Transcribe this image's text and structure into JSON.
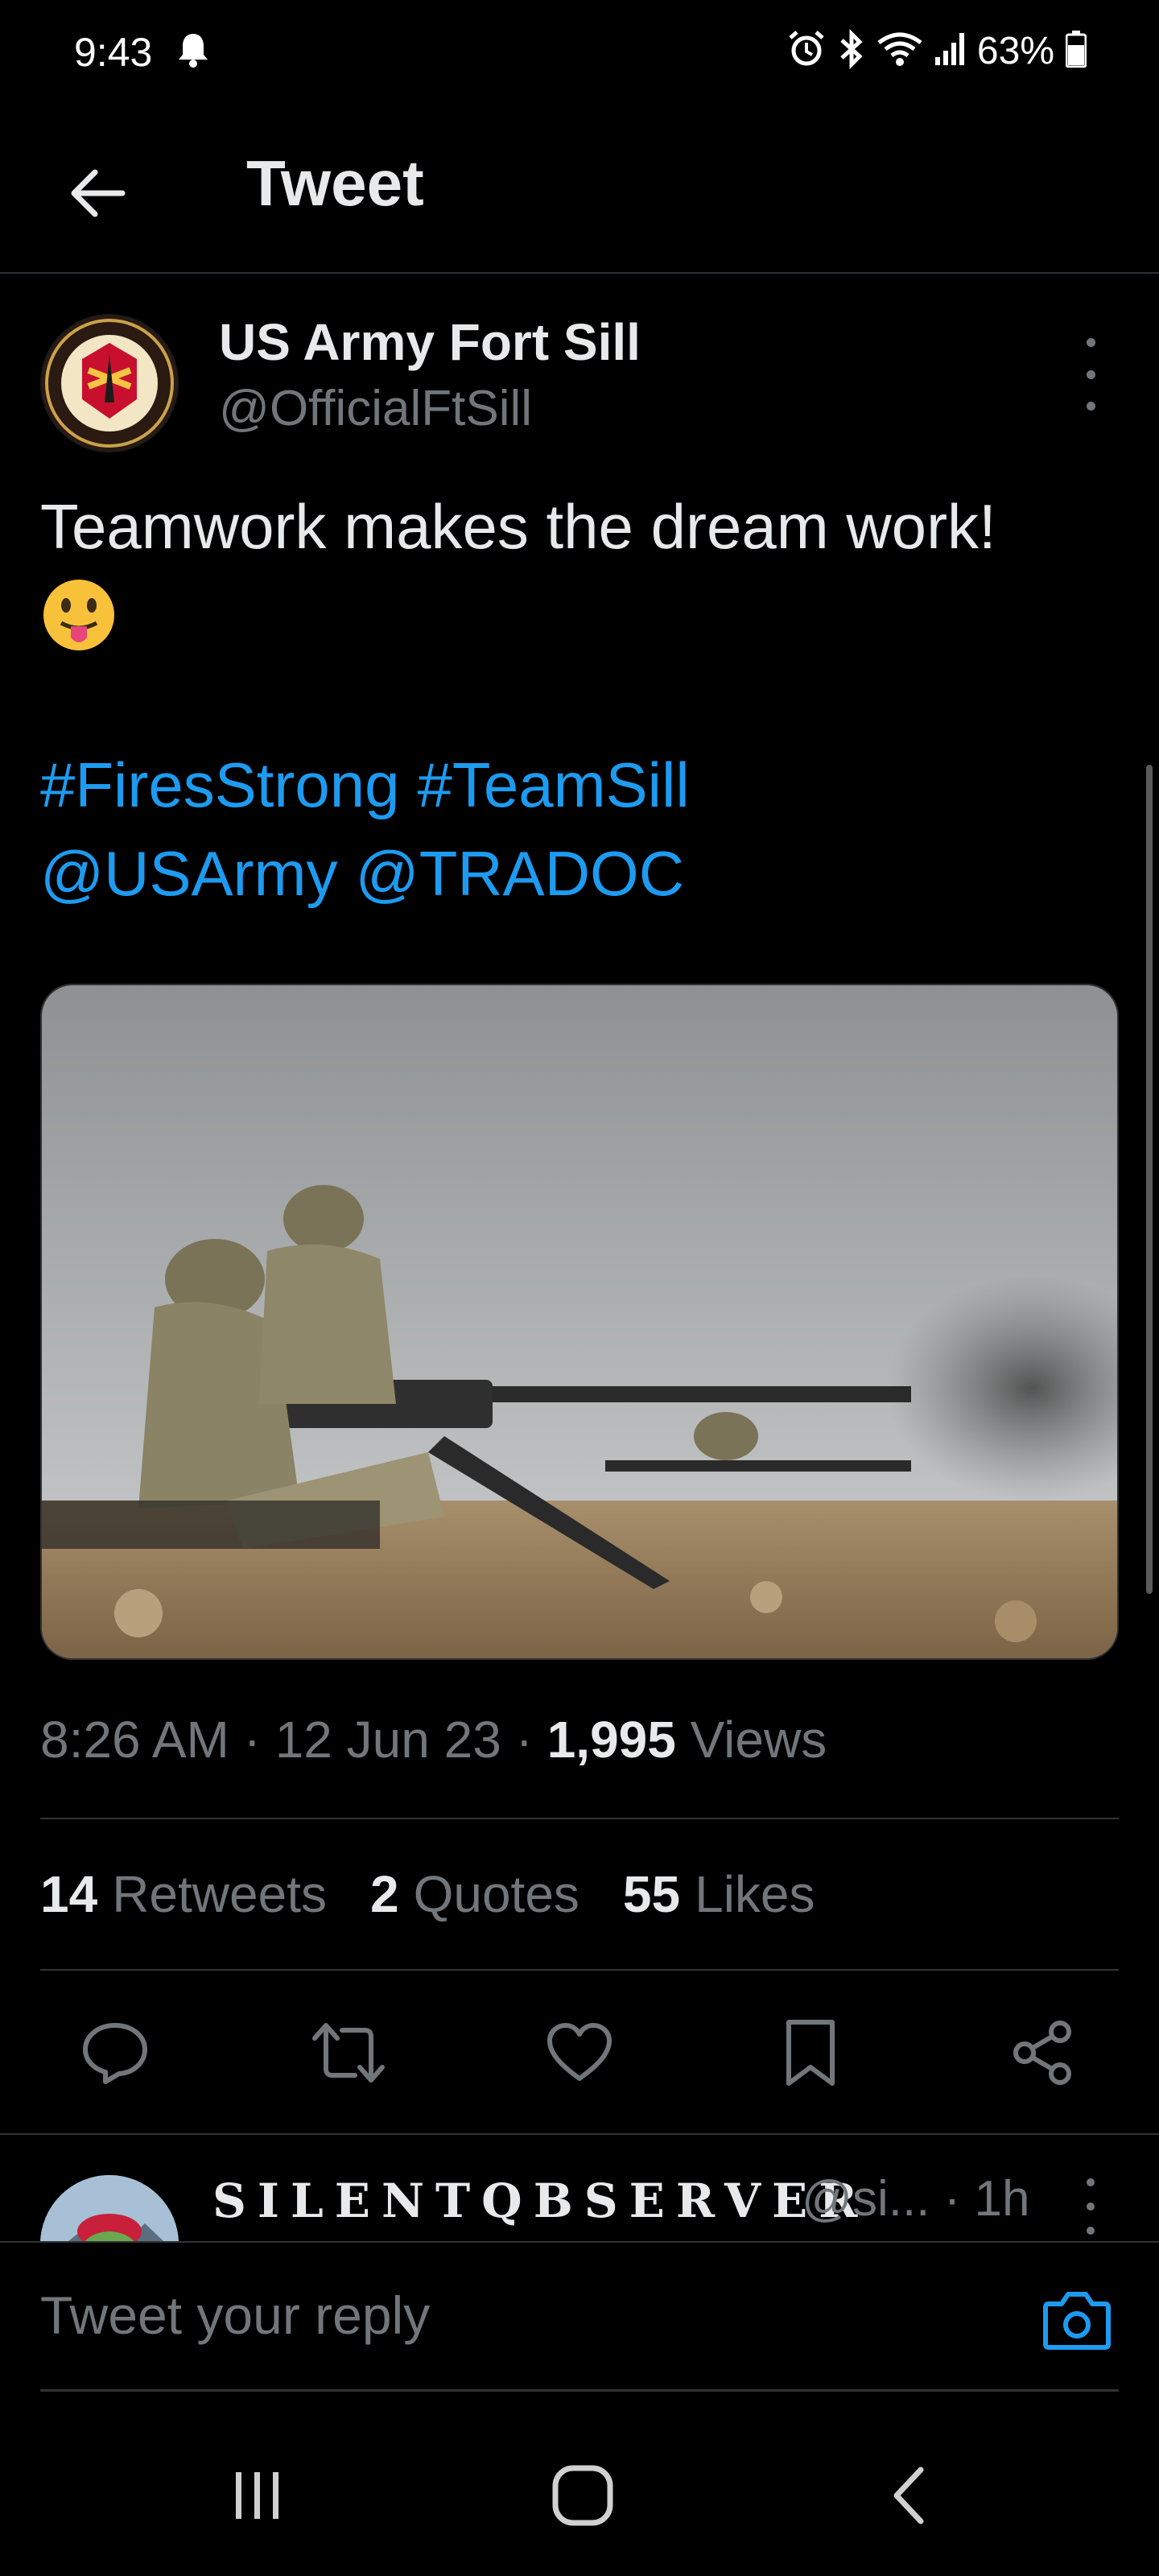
{
  "status_bar": {
    "time": "9:43",
    "battery": "63%",
    "icons": [
      "bell-icon",
      "alarm-icon",
      "bluetooth-icon",
      "wifi-icon",
      "signal-icon",
      "battery-icon"
    ]
  },
  "header": {
    "title": "Tweet",
    "back_icon": "back-arrow-icon"
  },
  "tweet": {
    "author_name": "US Army Fort Sill",
    "author_handle": "@OfficialFtSill",
    "text": "Teamwork makes the dream work!",
    "emoji": "😛",
    "hashtags": [
      "#FiresStrong",
      "#TeamSill"
    ],
    "mentions": [
      "@USArmy",
      "@TRADOC"
    ],
    "time": "8:26 AM",
    "date": "12 Jun 23",
    "views_count": "1,995",
    "views_label": "Views",
    "separator": "·",
    "stats": {
      "retweets_count": "14",
      "retweets_label": "Retweets",
      "quotes_count": "2",
      "quotes_label": "Quotes",
      "likes_count": "55",
      "likes_label": "Likes"
    }
  },
  "actions": [
    "reply-icon",
    "retweet-icon",
    "like-icon",
    "bookmark-icon",
    "share-icon"
  ],
  "reply_preview": {
    "name": "SILENTQBSERVER",
    "handle": "@si...",
    "time": "· 1h"
  },
  "reply_bar": {
    "placeholder": "Tweet your reply"
  },
  "colors": {
    "background": "#000000",
    "text": "#e7e9ea",
    "muted": "#71767b",
    "link": "#1d9bf0",
    "divider": "#2f3336"
  }
}
